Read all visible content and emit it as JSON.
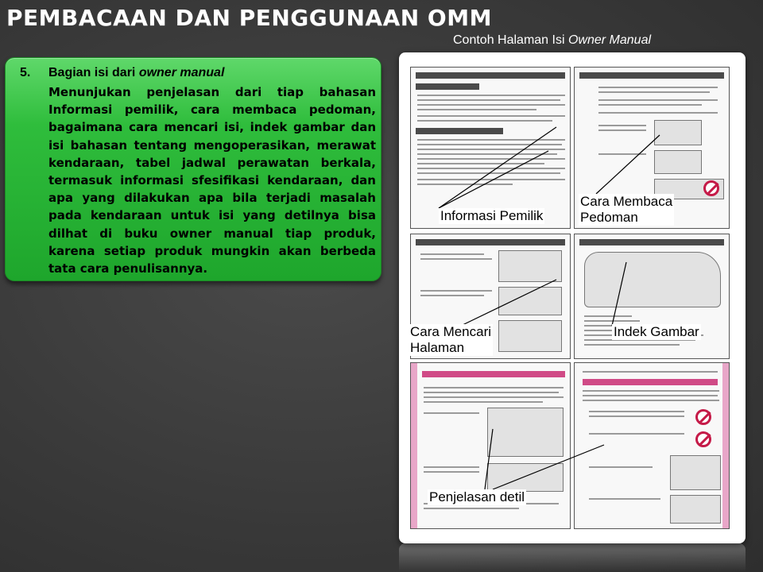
{
  "slide": {
    "title": "PEMBACAAN DAN PENGGUNAAN OMM",
    "subtitle_prefix": "Contoh Halaman Isi ",
    "subtitle_italic": "Owner Manual"
  },
  "greenbox": {
    "number": "5.",
    "heading_prefix": "Bagian isi dari ",
    "heading_italic": "owner manual",
    "paragraph": "Menunjukan penjelasan dari tiap bahasan Informasi pemilik, cara membaca pedoman, bagaimana cara mencari isi, indek gambar dan isi bahasan tentang mengoperasikan, merawat kendaraan, tabel jadwal perawatan berkala, termasuk informasi sfesifikasi kendaraan, dan apa yang dilakukan apa bila terjadi masalah pada kendaraan untuk isi yang detilnya bisa dilhat di buku owner manual tiap produk,  karena setiap produk mungkin akan berbeda  tata cara penulisannya."
  },
  "manual": {
    "callouts": {
      "informasi": "Informasi Pemilik",
      "cara_membaca_1": "Cara Membaca",
      "cara_membaca_2": "Pedoman",
      "cara_mencari_1": "Cara Mencari",
      "cara_mencari_2": "Halaman",
      "indek": "Indek Gambar",
      "penjelasan": "Penjelasan detil"
    },
    "colors": {
      "accent_pink": "#d04a86",
      "green": "#22ad30"
    }
  }
}
